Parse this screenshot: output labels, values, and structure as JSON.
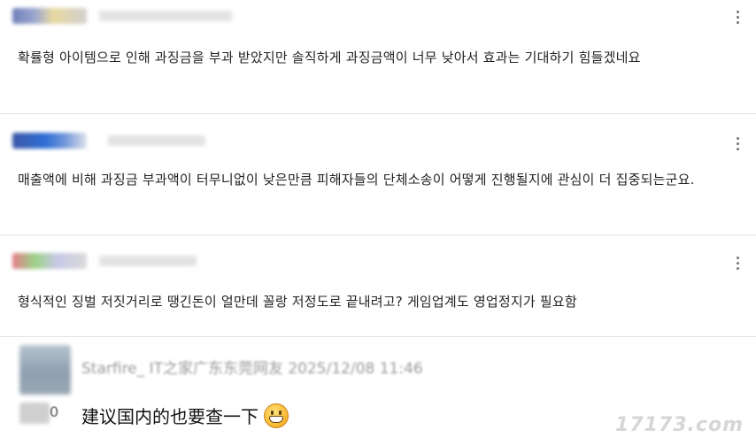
{
  "comments": [
    {
      "text": "확률형 아이템으로 인해 과징금을 부과 받았지만 솔직하게 과징금액이 너무 낮아서 효과는 기대하기 힘들겠네요",
      "avatar_colors": [
        "#7d8fbf",
        "#e7d9a0",
        "#c8c8c8"
      ]
    },
    {
      "text": "매출액에 비해 과징금 부과액이 터무니없이 낮은만큼 피해자들의 단체소송이 어떻게 진행될지에 관심이 더 집중되는군요.",
      "avatar_colors": [
        "#3f5aa8",
        "#2f6fd8",
        "#d8dce6"
      ]
    },
    {
      "text": "형식적인 징벌 저짓거리로 땡긴돈이 얼만데 꼴랑 저정도로 끝내려고? 게임업계도 영업정지가 필요함",
      "avatar_colors": [
        "#e87b8a",
        "#8fd07a",
        "#c5c5e6"
      ]
    }
  ],
  "reply": {
    "meta": "Starfire_ IT之家广东东莞网友 2025/12/08 11:46",
    "badge_digit": "0",
    "text": "建议国内的也要查一下",
    "emoji": "grin-emoji"
  },
  "watermark": "17173.com"
}
